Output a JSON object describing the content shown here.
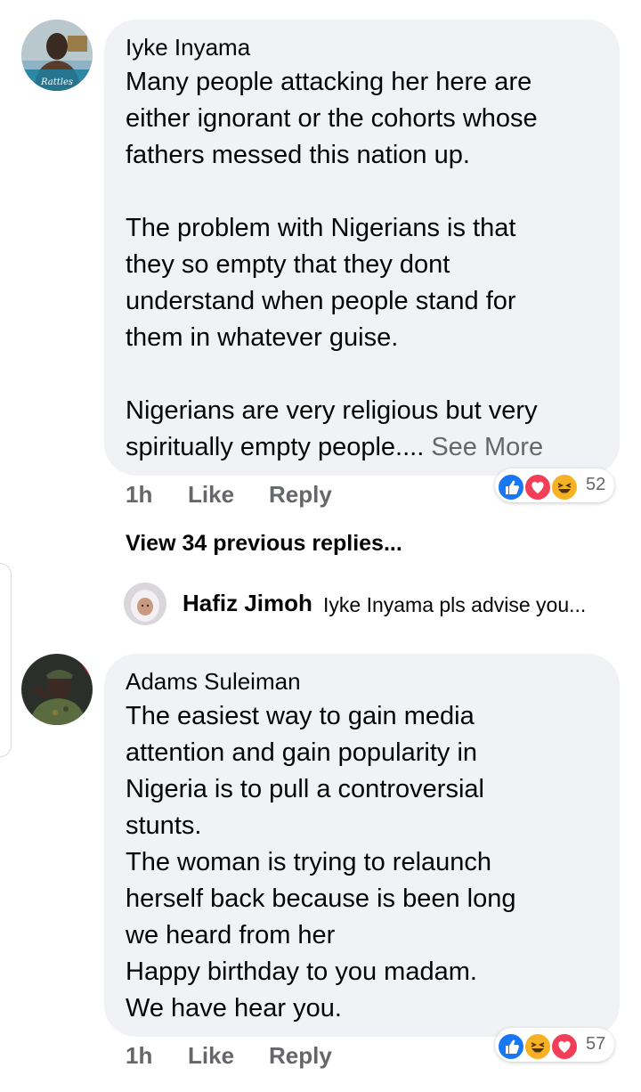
{
  "comments": [
    {
      "author": "Iyke Inyama",
      "avatar_caption": "Rattles",
      "text": "Many people attacking her here are\neither ignorant or the cohorts whose\nfathers messed this nation up.\n\nThe problem with Nigerians is that\nthey so empty that they dont\nunderstand  when people stand for\nthem in whatever guise.\n\nNigerians are very religious but very\nspiritually empty people....",
      "see_more": " See More",
      "time": "1h",
      "like_label": "Like",
      "reply_label": "Reply",
      "reaction_icons": [
        "like-icon",
        "love-icon",
        "haha-icon"
      ],
      "reaction_count": "52"
    },
    {
      "author": "Adams Suleiman",
      "text": "The easiest way to gain media\nattention and gain popularity in\nNigeria is to pull a controversial\nstunts.\nThe woman is trying to relaunch\nherself back because is been long\nwe heard from her\nHappy birthday to you madam.\nWe have hear you.",
      "time": "1h",
      "like_label": "Like",
      "reply_label": "Reply",
      "reaction_icons": [
        "like-icon",
        "haha-icon",
        "love-icon"
      ],
      "reaction_count": "57"
    }
  ],
  "view_previous_replies": "View 34 previous replies...",
  "reply_preview": {
    "author": "Hafiz Jimoh",
    "text": "Iyke Inyama pls advise you..."
  },
  "colors": {
    "bubble": "#f0f2f5",
    "secondary_text": "#65676b",
    "like": "#1877f2",
    "love": "#f33e58",
    "haha": "#f7b125"
  }
}
